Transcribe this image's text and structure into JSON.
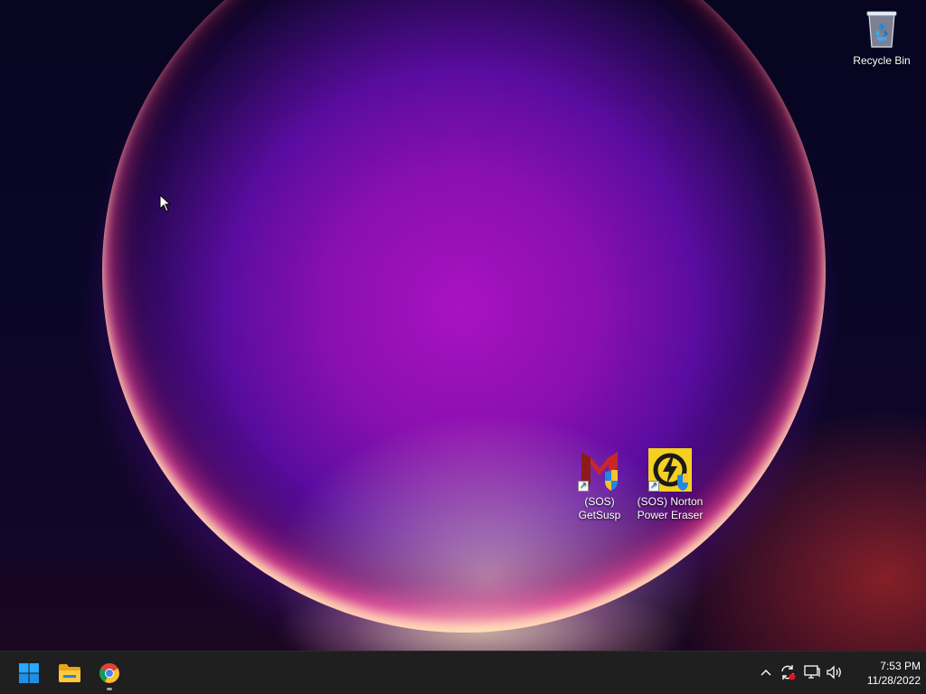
{
  "desktop": {
    "icons": [
      {
        "label": "Recycle Bin",
        "icon": "recycle-bin-icon"
      },
      {
        "label_line1": "(SOS)",
        "label_line2": "GetSusp",
        "icon": "getsusp-icon"
      },
      {
        "label_line1": "(SOS) Norton",
        "label_line2": "Power Eraser",
        "icon": "norton-power-eraser-icon"
      }
    ]
  },
  "taskbar": {
    "apps": [
      {
        "name": "Start",
        "icon": "windows-start-icon"
      },
      {
        "name": "File Explorer",
        "icon": "file-explorer-icon"
      },
      {
        "name": "Google Chrome",
        "icon": "chrome-icon",
        "running": true
      }
    ],
    "tray": {
      "icons": [
        "chevron-up-icon",
        "sync-icon",
        "network-icon",
        "volume-icon"
      ],
      "time": "7:53 PM",
      "date": "11/28/2022"
    }
  },
  "colors": {
    "taskbar_bg": "#1f1f1f",
    "accent": "#0078d4",
    "wallpaper_magenta": "#a812c0"
  }
}
